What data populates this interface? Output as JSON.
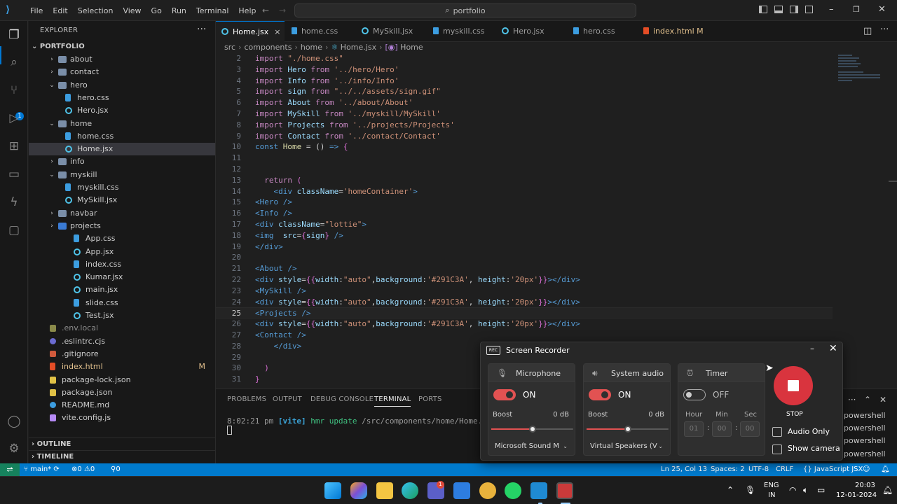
{
  "titlebar": {
    "menu": [
      "File",
      "Edit",
      "Selection",
      "View",
      "Go",
      "Run",
      "Terminal",
      "Help"
    ],
    "search": "portfolio",
    "back_icon": "arrow-left-icon",
    "forward_icon": "arrow-right-icon"
  },
  "activity": [
    "explorer-icon",
    "search-icon",
    "source-control-icon",
    "run-debug-icon",
    "extensions-icon",
    "remote-explorer-icon",
    "copilot-icon",
    "chat-icon",
    "account-icon",
    "manage-gear-icon"
  ],
  "activity_badge": "1",
  "sidebar": {
    "title": "EXPLORER",
    "more": "···",
    "project": "PORTFOLIO",
    "outline": "OUTLINE",
    "timeline": "TIMELINE",
    "tree": [
      {
        "label": "about",
        "type": "folder",
        "depth": 2,
        "open": false
      },
      {
        "label": "contact",
        "type": "folder",
        "depth": 2,
        "open": false
      },
      {
        "label": "hero",
        "type": "folder",
        "depth": 2,
        "open": true
      },
      {
        "label": "hero.css",
        "type": "css",
        "depth": 3
      },
      {
        "label": "Hero.jsx",
        "type": "jsx",
        "depth": 3
      },
      {
        "label": "home",
        "type": "folder",
        "depth": 2,
        "open": true
      },
      {
        "label": "home.css",
        "type": "css",
        "depth": 3
      },
      {
        "label": "Home.jsx",
        "type": "jsx",
        "depth": 3,
        "selected": true
      },
      {
        "label": "info",
        "type": "folder",
        "depth": 2,
        "open": false
      },
      {
        "label": "myskill",
        "type": "folder",
        "depth": 2,
        "open": true
      },
      {
        "label": "myskill.css",
        "type": "css",
        "depth": 3
      },
      {
        "label": "MySkill.jsx",
        "type": "jsx",
        "depth": 3
      },
      {
        "label": "navbar",
        "type": "folder",
        "depth": 2,
        "open": false
      },
      {
        "label": "projects",
        "type": "folder-b",
        "depth": 2,
        "open": false
      },
      {
        "label": "App.css",
        "type": "css",
        "depth": 2,
        "leaf": true
      },
      {
        "label": "App.jsx",
        "type": "jsx",
        "depth": 2,
        "leaf": true
      },
      {
        "label": "index.css",
        "type": "css",
        "depth": 2,
        "leaf": true
      },
      {
        "label": "Kumar.jsx",
        "type": "jsx",
        "depth": 2,
        "leaf": true
      },
      {
        "label": "main.jsx",
        "type": "jsx",
        "depth": 2,
        "leaf": true
      },
      {
        "label": "slide.css",
        "type": "css",
        "depth": 2,
        "leaf": true
      },
      {
        "label": "Test.jsx",
        "type": "jsx",
        "depth": 2,
        "leaf": true
      },
      {
        "label": ".env.local",
        "type": "env",
        "depth": 1,
        "dim": true
      },
      {
        "label": ".eslintrc.cjs",
        "type": "dot",
        "depth": 1
      },
      {
        "label": ".gitignore",
        "type": "git",
        "depth": 1
      },
      {
        "label": "index.html",
        "type": "html",
        "depth": 1,
        "modified": true,
        "badge": "M"
      },
      {
        "label": "package-lock.json",
        "type": "json",
        "depth": 1
      },
      {
        "label": "package.json",
        "type": "json",
        "depth": 1
      },
      {
        "label": "README.md",
        "type": "info",
        "depth": 1
      },
      {
        "label": "vite.config.js",
        "type": "vite",
        "depth": 1
      }
    ]
  },
  "tabs": [
    {
      "label": "Home.jsx",
      "type": "jsx",
      "active": true,
      "close": "×"
    },
    {
      "label": "home.css",
      "type": "css"
    },
    {
      "label": "MySkill.jsx",
      "type": "jsx"
    },
    {
      "label": "myskill.css",
      "type": "css"
    },
    {
      "label": "Hero.jsx",
      "type": "jsx"
    },
    {
      "label": "hero.css",
      "type": "css"
    },
    {
      "label": "index.html",
      "type": "html",
      "modified": true,
      "badge": "M"
    }
  ],
  "breadcrumb": [
    "src",
    "components",
    "home",
    "Home.jsx",
    "Home"
  ],
  "editor": {
    "current_line": 25,
    "lines": [
      {
        "n": 2,
        "code": [
          [
            "kw",
            "import "
          ],
          [
            "str",
            "\"./home.css\""
          ]
        ]
      },
      {
        "n": 3,
        "code": [
          [
            "kw",
            "import "
          ],
          [
            "id",
            "Hero "
          ],
          [
            "kw",
            "from "
          ],
          [
            "str",
            "'../hero/Hero'"
          ]
        ]
      },
      {
        "n": 4,
        "code": [
          [
            "kw",
            "import "
          ],
          [
            "id",
            "Info "
          ],
          [
            "kw",
            "from "
          ],
          [
            "str",
            "'../info/Info'"
          ]
        ]
      },
      {
        "n": 5,
        "code": [
          [
            "kw",
            "import "
          ],
          [
            "id",
            "sign "
          ],
          [
            "kw",
            "from "
          ],
          [
            "str",
            "\"../../assets/sign.gif\""
          ]
        ]
      },
      {
        "n": 6,
        "code": [
          [
            "kw",
            "import "
          ],
          [
            "id",
            "About "
          ],
          [
            "kw",
            "from "
          ],
          [
            "str",
            "'../about/About'"
          ]
        ]
      },
      {
        "n": 7,
        "code": [
          [
            "kw",
            "import "
          ],
          [
            "id",
            "MySkill "
          ],
          [
            "kw",
            "from "
          ],
          [
            "str",
            "'../myskill/MySkill'"
          ]
        ]
      },
      {
        "n": 8,
        "code": [
          [
            "kw",
            "import "
          ],
          [
            "id",
            "Projects "
          ],
          [
            "kw",
            "from "
          ],
          [
            "str",
            "'../projects/Projects'"
          ]
        ]
      },
      {
        "n": 9,
        "code": [
          [
            "kw",
            "import "
          ],
          [
            "id",
            "Contact "
          ],
          [
            "kw",
            "from "
          ],
          [
            "str",
            "'../contact/Contact'"
          ]
        ]
      },
      {
        "n": 10,
        "code": [
          [
            "kw2",
            "const "
          ],
          [
            "fn",
            "Home "
          ],
          [
            "plain",
            "= () "
          ],
          [
            "kw2",
            "=> "
          ],
          [
            "brace",
            "{"
          ]
        ]
      },
      {
        "n": 11,
        "code": []
      },
      {
        "n": 12,
        "code": []
      },
      {
        "n": 13,
        "code": [
          [
            "plain",
            "  "
          ],
          [
            "kw",
            "return "
          ],
          [
            "brace",
            "("
          ]
        ]
      },
      {
        "n": 14,
        "code": [
          [
            "plain",
            "    "
          ],
          [
            "tag",
            "<div "
          ],
          [
            "attr",
            "className"
          ],
          [
            "plain",
            "="
          ],
          [
            "str",
            "'homeContainer'"
          ],
          [
            "tag",
            ">"
          ]
        ]
      },
      {
        "n": 15,
        "code": [
          [
            "tag",
            "<Hero />"
          ]
        ]
      },
      {
        "n": 16,
        "code": [
          [
            "tag",
            "<Info />"
          ]
        ]
      },
      {
        "n": 17,
        "code": [
          [
            "tag",
            "<div "
          ],
          [
            "attr",
            "className"
          ],
          [
            "plain",
            "="
          ],
          [
            "str",
            "\"lottie\""
          ],
          [
            "tag",
            ">"
          ]
        ]
      },
      {
        "n": 18,
        "code": [
          [
            "tag",
            "<img  "
          ],
          [
            "attr",
            "src"
          ],
          [
            "plain",
            "="
          ],
          [
            "brace",
            "{"
          ],
          [
            "id",
            "sign"
          ],
          [
            "brace",
            "}"
          ],
          [
            "tag",
            " />"
          ]
        ]
      },
      {
        "n": 19,
        "code": [
          [
            "tag",
            "</div>"
          ]
        ]
      },
      {
        "n": 20,
        "code": []
      },
      {
        "n": 21,
        "code": [
          [
            "tag",
            "<About />"
          ]
        ]
      },
      {
        "n": 22,
        "code": [
          [
            "tag",
            "<div "
          ],
          [
            "attr",
            "style"
          ],
          [
            "plain",
            "="
          ],
          [
            "brace",
            "{{"
          ],
          [
            "id",
            "width"
          ],
          [
            "plain",
            ":"
          ],
          [
            "str",
            "\"auto\""
          ],
          [
            "plain",
            ","
          ],
          [
            "id",
            "background"
          ],
          [
            "plain",
            ":"
          ],
          [
            "str",
            "'#291C3A'"
          ],
          [
            "plain",
            ", "
          ],
          [
            "id",
            "height"
          ],
          [
            "plain",
            ":"
          ],
          [
            "str",
            "'20px'"
          ],
          [
            "brace",
            "}}"
          ],
          [
            "tag",
            "></div>"
          ]
        ]
      },
      {
        "n": 23,
        "code": [
          [
            "tag",
            "<MySkill />"
          ]
        ]
      },
      {
        "n": 24,
        "code": [
          [
            "tag",
            "<div "
          ],
          [
            "attr",
            "style"
          ],
          [
            "plain",
            "="
          ],
          [
            "brace",
            "{{"
          ],
          [
            "id",
            "width"
          ],
          [
            "plain",
            ":"
          ],
          [
            "str",
            "\"auto\""
          ],
          [
            "plain",
            ","
          ],
          [
            "id",
            "background"
          ],
          [
            "plain",
            ":"
          ],
          [
            "str",
            "'#291C3A'"
          ],
          [
            "plain",
            ", "
          ],
          [
            "id",
            "height"
          ],
          [
            "plain",
            ":"
          ],
          [
            "str",
            "'20px'"
          ],
          [
            "brace",
            "}}"
          ],
          [
            "tag",
            "></div>"
          ]
        ]
      },
      {
        "n": 25,
        "code": [
          [
            "tag",
            "<Projects />"
          ]
        ]
      },
      {
        "n": 26,
        "code": [
          [
            "tag",
            "<div "
          ],
          [
            "attr",
            "style"
          ],
          [
            "plain",
            "="
          ],
          [
            "brace",
            "{{"
          ],
          [
            "id",
            "width"
          ],
          [
            "plain",
            ":"
          ],
          [
            "str",
            "\"auto\""
          ],
          [
            "plain",
            ","
          ],
          [
            "id",
            "background"
          ],
          [
            "plain",
            ":"
          ],
          [
            "str",
            "'#291C3A'"
          ],
          [
            "plain",
            ", "
          ],
          [
            "id",
            "height"
          ],
          [
            "plain",
            ":"
          ],
          [
            "str",
            "'20px'"
          ],
          [
            "brace",
            "}}"
          ],
          [
            "tag",
            "></div>"
          ]
        ]
      },
      {
        "n": 27,
        "code": [
          [
            "tag",
            "<Contact />"
          ]
        ]
      },
      {
        "n": 28,
        "code": [
          [
            "plain",
            "    "
          ],
          [
            "tag",
            "</div>"
          ]
        ]
      },
      {
        "n": 29,
        "code": []
      },
      {
        "n": 30,
        "code": [
          [
            "plain",
            "  "
          ],
          [
            "brace",
            ")"
          ]
        ]
      },
      {
        "n": 31,
        "code": [
          [
            "brace",
            "}"
          ]
        ]
      }
    ]
  },
  "panel": {
    "tabs": [
      "PROBLEMS",
      "OUTPUT",
      "DEBUG CONSOLE",
      "TERMINAL",
      "PORTS"
    ],
    "active_tab": "TERMINAL",
    "terminal": {
      "time": "8:02:21 pm",
      "tag": "[vite]",
      "msg": "hmr update",
      "path": "/src/components/home/Home.jsx"
    },
    "terminals": [
      "powershell",
      "powershell",
      "powershell",
      "powershell"
    ],
    "more": "···"
  },
  "statusbar": {
    "branch": "main*",
    "errors": "0",
    "warnings": "0",
    "ports": "0",
    "position": "Ln 25, Col 13",
    "spaces": "Spaces: 2",
    "encoding": "UTF-8",
    "eol": "CRLF",
    "language": "JavaScript JSX"
  },
  "recorder": {
    "title": "Screen Recorder",
    "logo": "REC",
    "mic": {
      "title": "Microphone",
      "state": "ON",
      "boost": "Boost",
      "db": "0 dB",
      "device": "Microsoft Sound M",
      "level": 0.5
    },
    "sys": {
      "title": "System audio",
      "state": "ON",
      "boost": "Boost",
      "db": "0 dB",
      "device": "Virtual Speakers (V",
      "level": 0.5
    },
    "timer": {
      "title": "Timer",
      "state": "OFF",
      "hour": "Hour",
      "min": "Min",
      "sec": "Sec",
      "h": "01",
      "m": "00",
      "s": "00"
    },
    "stop": "STOP",
    "audio_only": "Audio Only",
    "show_camera": "Show camera"
  },
  "taskbar": {
    "icons": [
      "windows-start-icon",
      "copilot-app-icon",
      "file-explorer-icon",
      "edge-browser-icon",
      "teams-icon",
      "microsoft-store-icon",
      "trophy-app-icon",
      "whatsapp-icon",
      "vscode-icon",
      "screen-recorder-icon"
    ],
    "teams_badge": "1",
    "lang1": "ENG",
    "lang2": "IN",
    "time": "20:03",
    "date": "12-01-2024"
  }
}
